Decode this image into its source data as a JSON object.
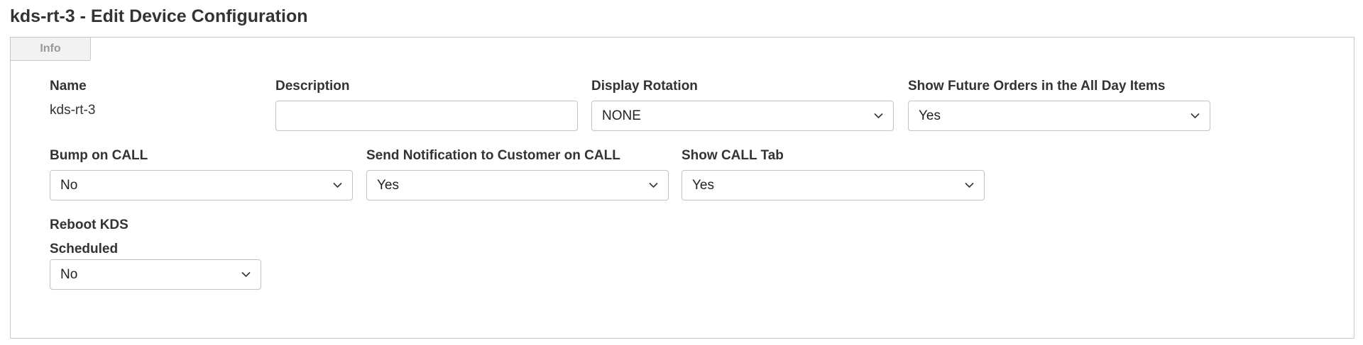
{
  "page": {
    "title": "kds-rt-3 - Edit Device Configuration"
  },
  "tabs": [
    {
      "label": "Info",
      "active": true
    }
  ],
  "fields": {
    "name": {
      "label": "Name",
      "value": "kds-rt-3"
    },
    "description": {
      "label": "Description",
      "value": "",
      "placeholder": ""
    },
    "display_rotation": {
      "label": "Display Rotation",
      "value": "NONE"
    },
    "show_future_orders": {
      "label": "Show Future Orders in the All Day Items",
      "value": "Yes"
    },
    "bump_on_call": {
      "label": "Bump on CALL",
      "value": "No"
    },
    "send_notification": {
      "label": "Send Notification to Customer on CALL",
      "value": "Yes"
    },
    "show_call_tab": {
      "label": "Show CALL Tab",
      "value": "Yes"
    },
    "reboot_kds": {
      "label": "Reboot KDS"
    },
    "scheduled": {
      "label": "Scheduled",
      "value": "No"
    }
  },
  "icons": {
    "dropdown": "chevron-down-icon"
  },
  "colors": {
    "border": "#c3c3c3",
    "text": "#333333",
    "tab_bg": "#f2f2f2",
    "tab_text": "#999999"
  }
}
